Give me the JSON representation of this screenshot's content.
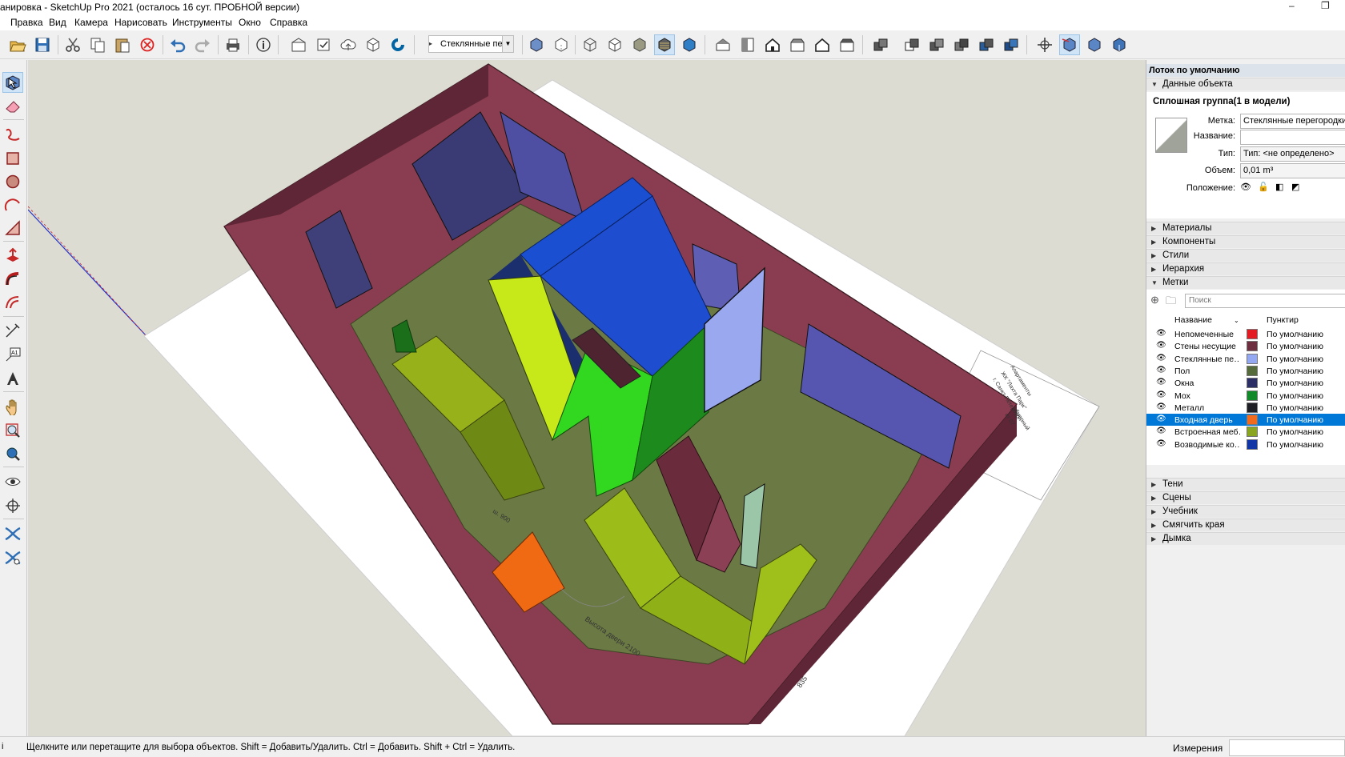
{
  "window": {
    "title": "анировка - SketchUp Pro 2021 (осталось 16 сут. ПРОБНОЙ версии)",
    "minimize_glyph": "–",
    "restore_glyph": "❐"
  },
  "menu": [
    "Правка",
    "Вид",
    "Камера",
    "Нарисовать",
    "Инструменты",
    "Окно",
    "Справка"
  ],
  "toolbar": {
    "active_tag": "Стеклянные перегородки",
    "icons": [
      "open-icon",
      "save-icon",
      "cut-icon",
      "copy-icon",
      "paste-icon",
      "erase-icon",
      "undo-icon",
      "redo-icon",
      "print-icon",
      "model-info-icon",
      "warehouse-icon",
      "add-location-icon",
      "cloud-icon",
      "extension-warehouse-icon",
      "trimble-icon",
      "xray-icon",
      "back-edges-icon",
      "wireframe-icon",
      "hidden-line-icon",
      "shaded-icon",
      "shaded-textures-icon",
      "monochrome-icon",
      "iso-view-icon",
      "top-view-icon",
      "front-view-icon",
      "right-view-icon",
      "back-view-icon",
      "left-view-icon",
      "union-icon",
      "subtract-icon",
      "intersect-icon",
      "trim-icon",
      "split-icon",
      "outer-shell-icon",
      "axes-icon",
      "section-plane-icon",
      "display-section-icon",
      "section-fill-icon"
    ]
  },
  "left_tools": [
    "select-icon",
    "eraser-icon",
    "freehand-icon",
    "rectangle-icon",
    "circle-icon",
    "arc-icon",
    "polygon-icon",
    "push-pull-icon",
    "follow-me-icon",
    "offset-icon",
    "tape-measure-icon",
    "text-icon",
    "3d-text-icon",
    "pan-icon",
    "zoom-window-icon",
    "zoom-extents-icon",
    "look-around-icon",
    "walk-icon",
    "sandbox-icon",
    "sandbox-settings-icon"
  ],
  "tray": {
    "title": "Лоток по умолчанию",
    "entity_info": {
      "header": "Данные объекта",
      "title": "Сплошная группа(1 в модели)",
      "tag_label": "Метка:",
      "tag_value": "Стеклянные перегородки",
      "name_label": "Название:",
      "name_value": "",
      "type_label": "Тип:",
      "type_value": "Тип: <не определено>",
      "volume_label": "Объем:",
      "volume_value": "0,01 m³",
      "position_label": "Положение:"
    },
    "sections_top": [
      "Материалы",
      "Компоненты",
      "Стили",
      "Иерархия",
      "Метки"
    ],
    "tags": {
      "search_placeholder": "Поиск",
      "col_name": "Название",
      "col_dash": "Пунктир",
      "rows": [
        {
          "name": "Непомеченные",
          "color": "#e31b23",
          "dash": "По умолчанию",
          "selected": false
        },
        {
          "name": "Стены несущие",
          "color": "#6d2e3f",
          "dash": "По умолчанию",
          "selected": false
        },
        {
          "name": "Стеклянные пе…",
          "color": "#93a8f0",
          "dash": "По умолчанию",
          "selected": false
        },
        {
          "name": "Пол",
          "color": "#566b3c",
          "dash": "По умолчанию",
          "selected": false
        },
        {
          "name": "Окна",
          "color": "#2c2e66",
          "dash": "По умолчанию",
          "selected": false
        },
        {
          "name": "Мох",
          "color": "#138a2a",
          "dash": "По умолчанию",
          "selected": false
        },
        {
          "name": "Металл",
          "color": "#1d1f24",
          "dash": "По умолчанию",
          "selected": false
        },
        {
          "name": "Входная дверь",
          "color": "#f26a1b",
          "dash": "По умолчанию",
          "selected": true
        },
        {
          "name": "Встроенная меб…",
          "color": "#8aa51f",
          "dash": "По умолчанию",
          "selected": false
        },
        {
          "name": "Возводимые ко…",
          "color": "#1236a6",
          "dash": "По умолчанию",
          "selected": false
        }
      ]
    },
    "sections_bottom": [
      "Тени",
      "Сцены",
      "Учебник",
      "Смягчить края",
      "Дымка"
    ]
  },
  "plan_labels": {
    "door_height": "Высота двери 2100",
    "door_width": "ш. 900",
    "dimension": "835",
    "stamp_1": "Апартаменты",
    "stamp_2": "ЖК \"Лахта Парк\"",
    "stamp_3": "г. Санкт-Петербург",
    "stamp_4": "обмерный",
    "stamp_5": "от 07"
  },
  "status": {
    "hint": "Щелкните или перетащите для выбора объектов. Shift = Добавить/Удалить. Ctrl = Добавить. Shift + Ctrl = Удалить.",
    "measure_label": "Измерения",
    "measure_value": "",
    "info_glyph": "i"
  }
}
